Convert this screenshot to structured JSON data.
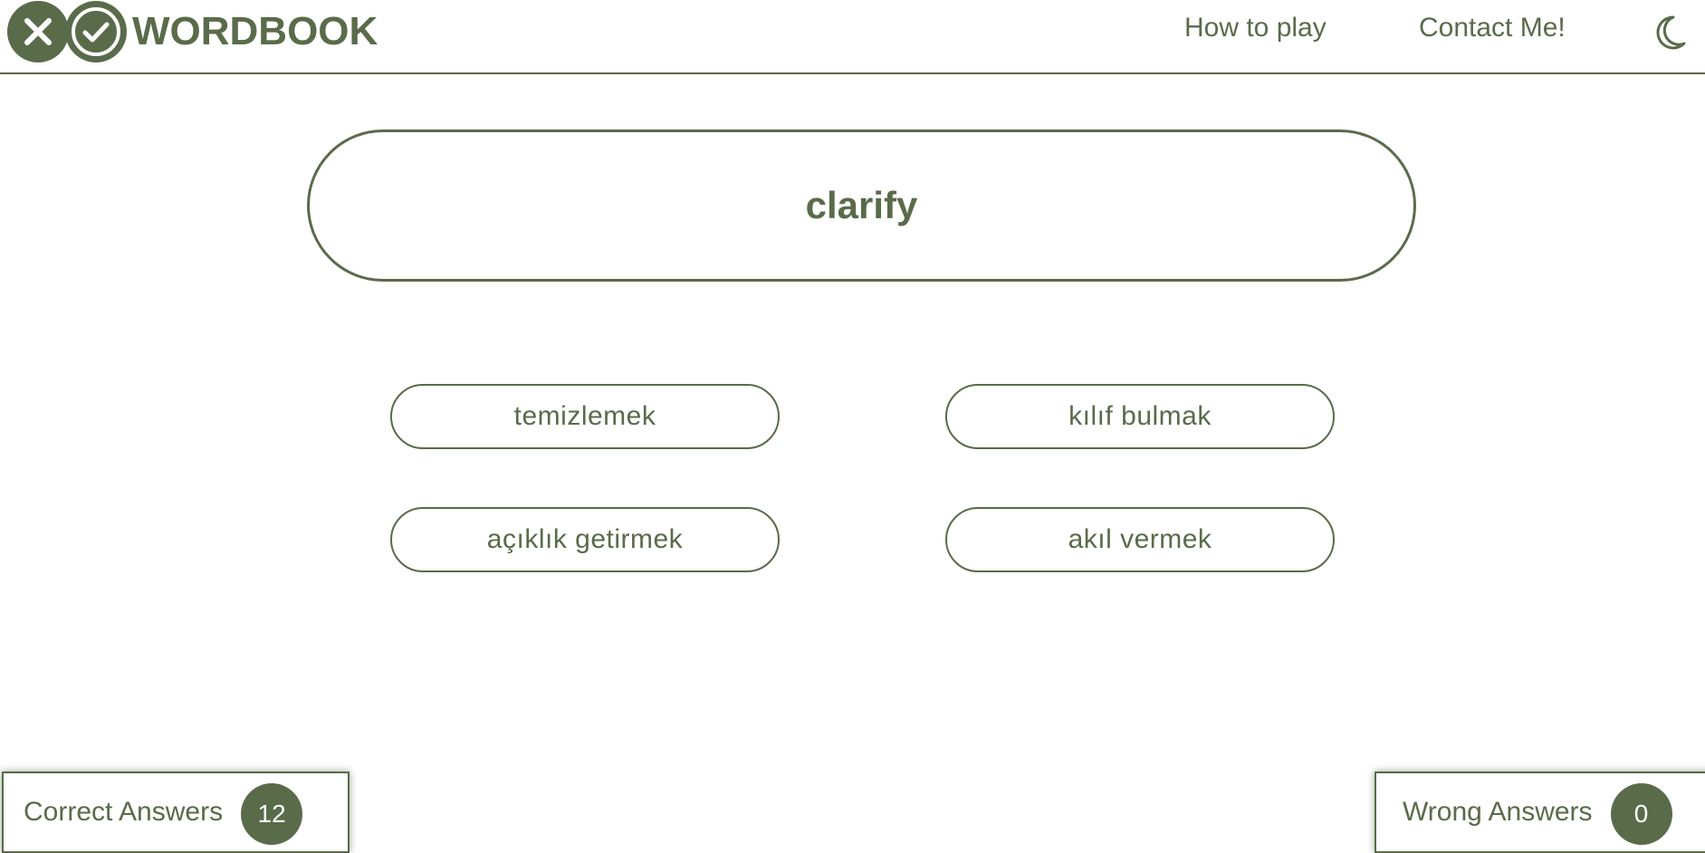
{
  "header": {
    "brand": "WORDBOOK",
    "nav": {
      "how_to_play": "How to play",
      "contact": "Contact Me!"
    },
    "theme_toggle_icon": "moon-icon"
  },
  "quiz": {
    "word": "clarify",
    "options": [
      "temizlemek",
      "kılıf bulmak",
      "açıklık getirmek",
      "akıl vermek"
    ]
  },
  "scores": {
    "correct_label": "Correct Answers",
    "correct_count": "12",
    "wrong_label": "Wrong Answers",
    "wrong_count": "0"
  },
  "colors": {
    "accent": "#5a6b4a",
    "background": "#ffffff"
  }
}
